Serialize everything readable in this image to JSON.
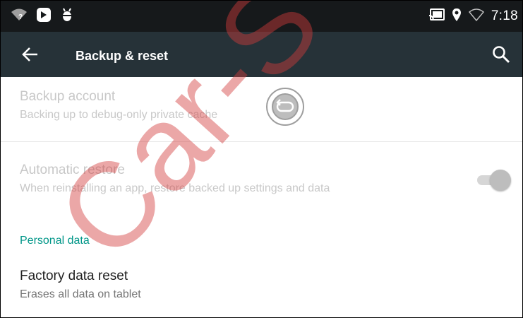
{
  "status_bar": {
    "time": "7:18",
    "left_icons": [
      "wifi-unknown-icon",
      "notification-icon",
      "android-debug-icon"
    ],
    "right_icons": [
      "cast-icon",
      "location-icon",
      "signal-icon"
    ]
  },
  "toolbar": {
    "title": "Backup & reset",
    "back_icon": "arrow-back-icon",
    "search_icon": "search-icon",
    "color": "#263238"
  },
  "preferences": [
    {
      "title": "Backup account",
      "summary": "Backing up to debug-only private cache",
      "enabled": false
    },
    {
      "title": "Automatic restore",
      "summary": "When reinstalling an app, restore backed up settings and data",
      "enabled": false,
      "toggle_on": true
    }
  ],
  "category": {
    "label": "Personal data",
    "color": "#009688"
  },
  "factory_reset": {
    "title": "Factory data reset",
    "summary": "Erases all data on tablet"
  },
  "watermark": {
    "text": "Car-S"
  }
}
